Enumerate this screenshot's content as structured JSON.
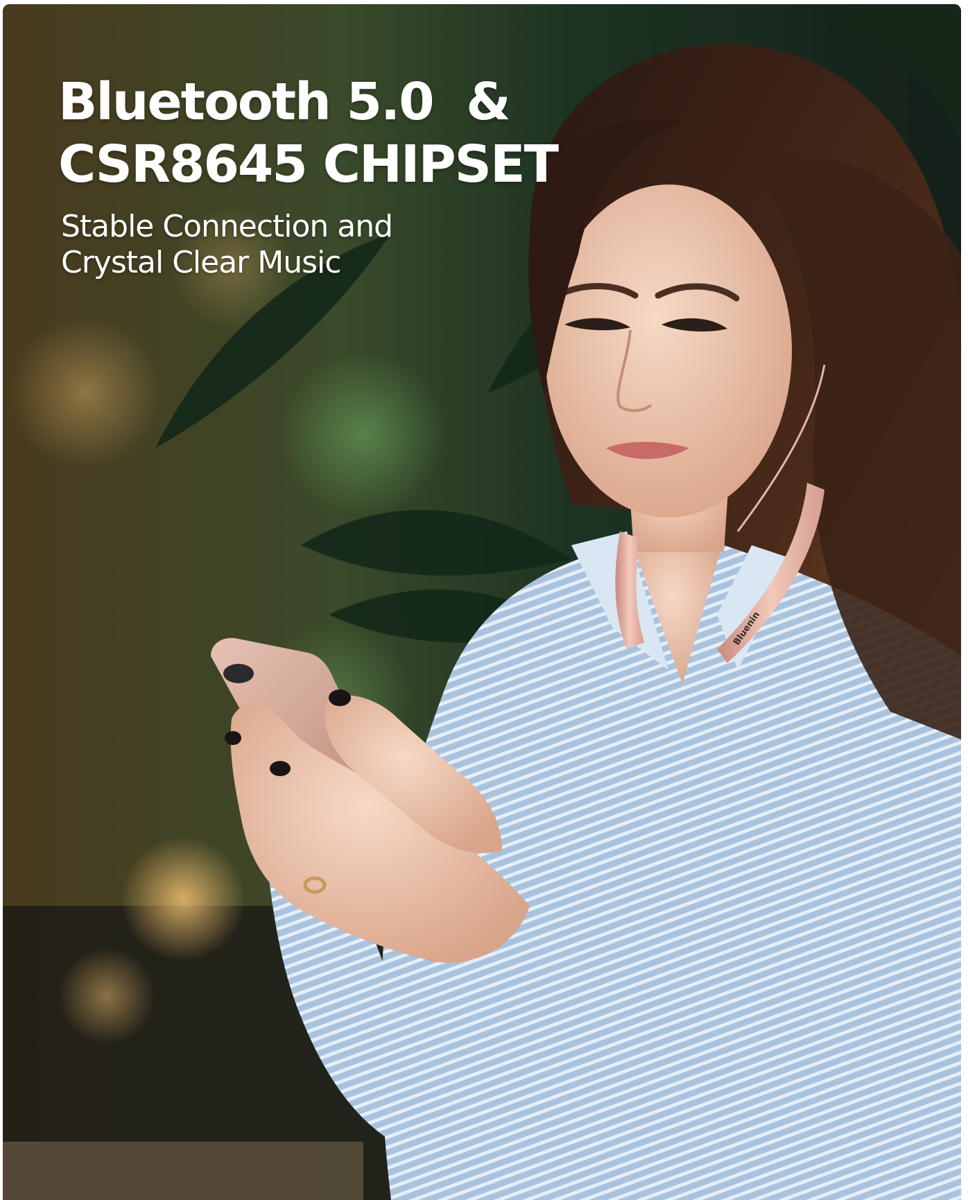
{
  "headline": {
    "line1": "Bluetooth 5.0  &",
    "line2": "CSR8645 CHIPSET"
  },
  "subhead": {
    "line1": "Stable Connection and",
    "line2": "Crystal Clear Music"
  },
  "headset_brand": "Bluenin",
  "colors": {
    "headset": "#e8b5a8",
    "phone": "#d9b2a3",
    "shirt": "#9fbbd9",
    "hair": "#3a2218",
    "foliage": "#1f3a22",
    "bokeh_warm": "#c98a3a"
  }
}
